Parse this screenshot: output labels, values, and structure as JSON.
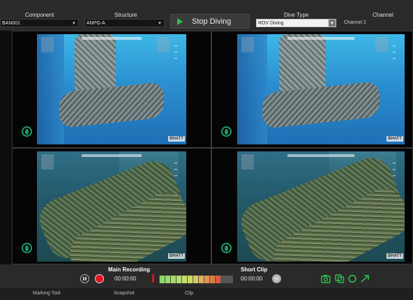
{
  "toolbar": {
    "component_label": "Component",
    "component_value": "BAN001",
    "structure_label": "Structure",
    "structure_value": "ANPG-A",
    "stop_button_label": "Stop Diving",
    "dive_type_label": "Dive Type",
    "dive_type_value": "ROV Diving",
    "channel_label": "Channel",
    "channel_value": "Channel 2"
  },
  "video": {
    "watermark_brand": "BHATT"
  },
  "controls": {
    "main_recording_label": "Main Recording",
    "main_recording_time": "00:00:00",
    "short_clip_label": "Short Clip",
    "short_clip_time": "00:00:00",
    "meter_colors": [
      "#8fd46a",
      "#9ad86a",
      "#a8dc6a",
      "#b4dd6a",
      "#c2de68",
      "#cfd966",
      "#d9c85f",
      "#dfb058",
      "#e2974f",
      "#e07a47",
      "#dc5c40"
    ]
  },
  "statusbar": {
    "marking_tool": "Marking Tool",
    "snapshot": "Snapshot",
    "clip": "Clip"
  },
  "colors": {
    "accent_green": "#2ec24a",
    "record_red": "#e0141e"
  }
}
